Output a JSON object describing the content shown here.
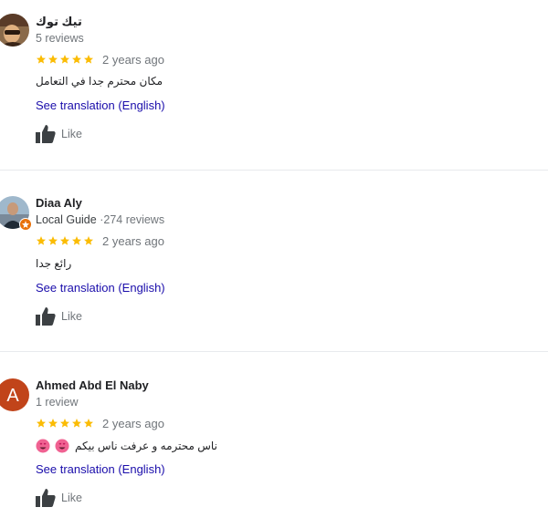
{
  "reviews": [
    {
      "name": "تيك توك",
      "meta": "5 reviews",
      "rating": 5,
      "age": "2 years ago",
      "text": "مكان محترم جدا في التعامل",
      "translate_label": "See translation (English)",
      "like_label": "Like"
    },
    {
      "name": "Diaa Aly",
      "guide_label": "Local Guide",
      "meta": "274 reviews",
      "separator": "·",
      "rating": 5,
      "age": "2 years ago",
      "text": "رائع جدا",
      "translate_label": "See translation (English)",
      "like_label": "Like"
    },
    {
      "name": "Ahmed Abd El Naby",
      "avatar_letter": "A",
      "avatar_color": "#c1441a",
      "meta": "1 review",
      "rating": 5,
      "age": "2 years ago",
      "text": "ناس محترمه و عرفت ناس بيكم",
      "emojis": [
        "smiling-face-with-heart-eyes",
        "smiling-face-with-heart-eyes"
      ],
      "translate_label": "See translation (English)",
      "like_label": "Like"
    }
  ],
  "colors": {
    "star": "#fbbc04",
    "link": "#1a0dab",
    "secondary_text": "#70757a",
    "divider": "#e8eaed"
  }
}
